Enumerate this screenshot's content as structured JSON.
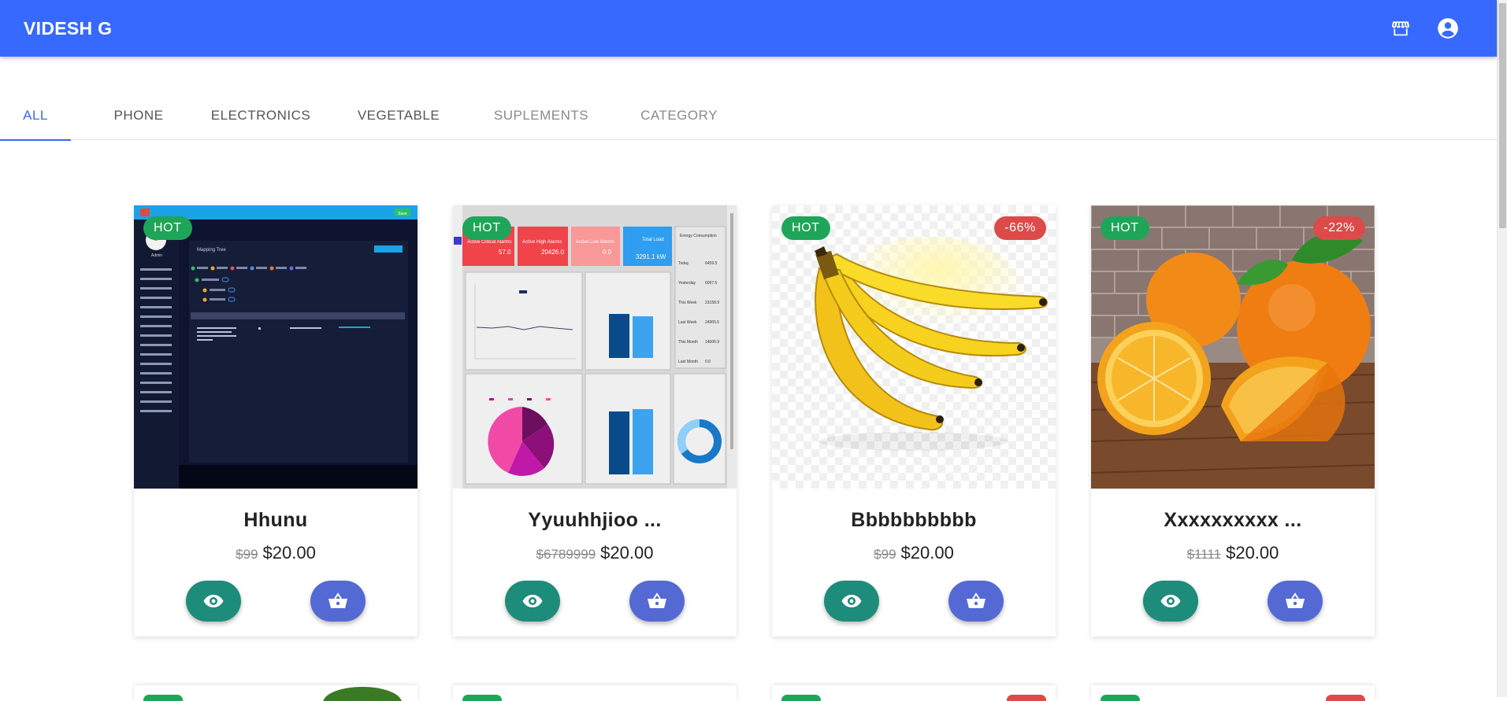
{
  "appbar": {
    "brand": "VIDESH G",
    "icons": [
      "store-icon",
      "account-circle-icon"
    ],
    "color": "#3768ff"
  },
  "tabs": [
    {
      "label": "ALL",
      "active": true
    },
    {
      "label": "PHONE",
      "active": false
    },
    {
      "label": "ELECTRONICS",
      "active": false
    },
    {
      "label": "VEGETABLE",
      "active": false
    },
    {
      "label": "SUPLEMENTS",
      "active": false
    },
    {
      "label": "CATEGORY",
      "active": false
    }
  ],
  "products": [
    {
      "name": "Hhunu",
      "old_price": "$99",
      "price": "$20.00",
      "hot": "HOT",
      "discount": "",
      "image": "dashboard-screenshot-dark"
    },
    {
      "name": "Yyuuhhjioo ...",
      "old_price": "$6789999",
      "price": "$20.00",
      "hot": "HOT",
      "discount": "",
      "image": "energy-dashboard-screenshot"
    },
    {
      "name": "Bbbbbbbbbb",
      "old_price": "$99",
      "price": "$20.00",
      "hot": "HOT",
      "discount": "-66%",
      "image": "bananas"
    },
    {
      "name": "Xxxxxxxxxx ...",
      "old_price": "$1111",
      "price": "$20.00",
      "hot": "HOT",
      "discount": "-22%",
      "image": "oranges"
    }
  ],
  "thumb_text": {
    "dashboard": {
      "header": "Mapping Tree",
      "button": "Save",
      "user": "Admin"
    },
    "energy": {
      "kpis": [
        {
          "label": "Active Critical Alarms",
          "value": "57.0"
        },
        {
          "label": "Active High Alarms",
          "value": "20426.0"
        },
        {
          "label": "Active Low Alarms",
          "value": "0.0"
        },
        {
          "label": "Total Load",
          "value": "3291.1 kW"
        }
      ],
      "consumption_title": "Energy Consumption",
      "consumption_rows": [
        {
          "label": "Today",
          "value": "6459.5"
        },
        {
          "label": "Yesterday",
          "value": "6097.5"
        },
        {
          "label": "This Week",
          "value": "23158.9"
        },
        {
          "label": "Last Week",
          "value": "24905.5"
        },
        {
          "label": "This Month",
          "value": "14606.9"
        },
        {
          "label": "Last Month",
          "value": "0.0"
        }
      ]
    }
  },
  "buttons": {
    "view_icon": "eye-icon",
    "cart_icon": "shopping-basket-icon"
  },
  "colors": {
    "hot_badge": "#1fa55a",
    "discount_badge": "#dc4a4a",
    "view_button": "#1e8c7a",
    "cart_button": "#5469d4"
  }
}
